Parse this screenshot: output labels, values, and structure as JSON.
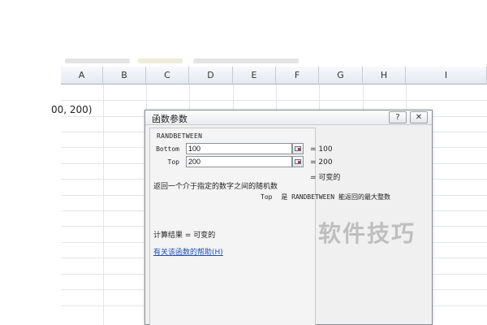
{
  "spreadsheet": {
    "columns": [
      "A",
      "B",
      "C",
      "D",
      "E",
      "F",
      "G",
      "H",
      "I"
    ],
    "cell_fragment": "00, 200)"
  },
  "dialog": {
    "title": "函数参数",
    "help_button": "?",
    "close_button": "✕",
    "function_name": "RANDBETWEEN",
    "args": [
      {
        "label": "Bottom",
        "value": "100",
        "result": "= 100"
      },
      {
        "label": "Top",
        "value": "200",
        "result": "= 200"
      }
    ],
    "function_result": "= 可变的",
    "description": "返回一个介于指定的数字之间的随机数",
    "arg_help": {
      "name": "Top",
      "text": "是 RANDBETWEEN 能返回的最大整数"
    },
    "calc_result": "计算结果 =  可变的",
    "help_link": "有关该函数的帮助(H)"
  },
  "watermark": "软件技巧"
}
